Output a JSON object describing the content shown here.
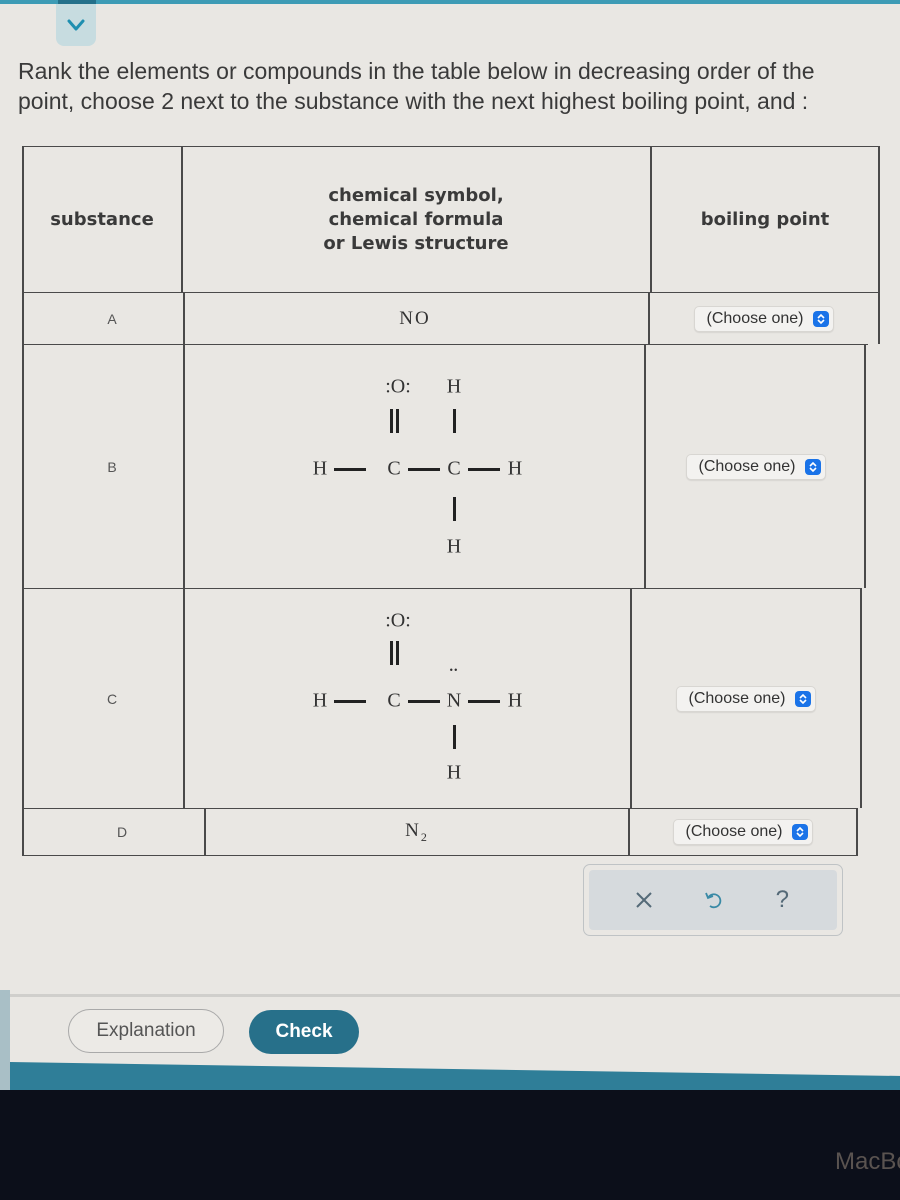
{
  "header": {
    "collapse_icon": "chevron-down-icon",
    "accent_color": "#3d9bb5"
  },
  "prompt": {
    "line1": "Rank the elements or compounds in the table below in decreasing order of the",
    "line2": "point, choose 2 next to the substance with the next highest boiling point, and :"
  },
  "table": {
    "headers": {
      "substance": "substance",
      "formula": [
        "chemical symbol,",
        "chemical formula",
        "or Lewis structure"
      ],
      "boiling_point": "boiling point"
    },
    "rows": [
      {
        "label": "A",
        "formula": "NO",
        "formula_type": "text",
        "select_value": "(Choose one)"
      },
      {
        "label": "B",
        "formula_type": "lewis",
        "select_value": "(Choose one)",
        "lewis": {
          "o": ":O:",
          "h_top": "H",
          "h_left": "H",
          "c1": "C",
          "c2": "C",
          "h_right": "H",
          "h_bottom": "H"
        }
      },
      {
        "label": "C",
        "formula_type": "lewis",
        "select_value": "(Choose one)",
        "lewis": {
          "o": ":O:",
          "h_left": "H",
          "c1": "C",
          "n": "N",
          "n_lone_pair": "••",
          "h_right": "H",
          "h_bottom": "H"
        }
      },
      {
        "label": "D",
        "formula_main": "N",
        "formula_sub": "2",
        "formula_type": "text",
        "select_value": "(Choose one)"
      }
    ],
    "select_arrow_color": "#1a73e8"
  },
  "toolbar": {
    "clear_icon": "close-icon",
    "undo_icon": "undo-icon",
    "help_icon": "help-icon",
    "help_glyph": "?"
  },
  "actions": {
    "explanation_label": "Explanation",
    "check_label": "Check",
    "check_color": "#27708a"
  },
  "device": {
    "brand_text": "MacBo"
  }
}
